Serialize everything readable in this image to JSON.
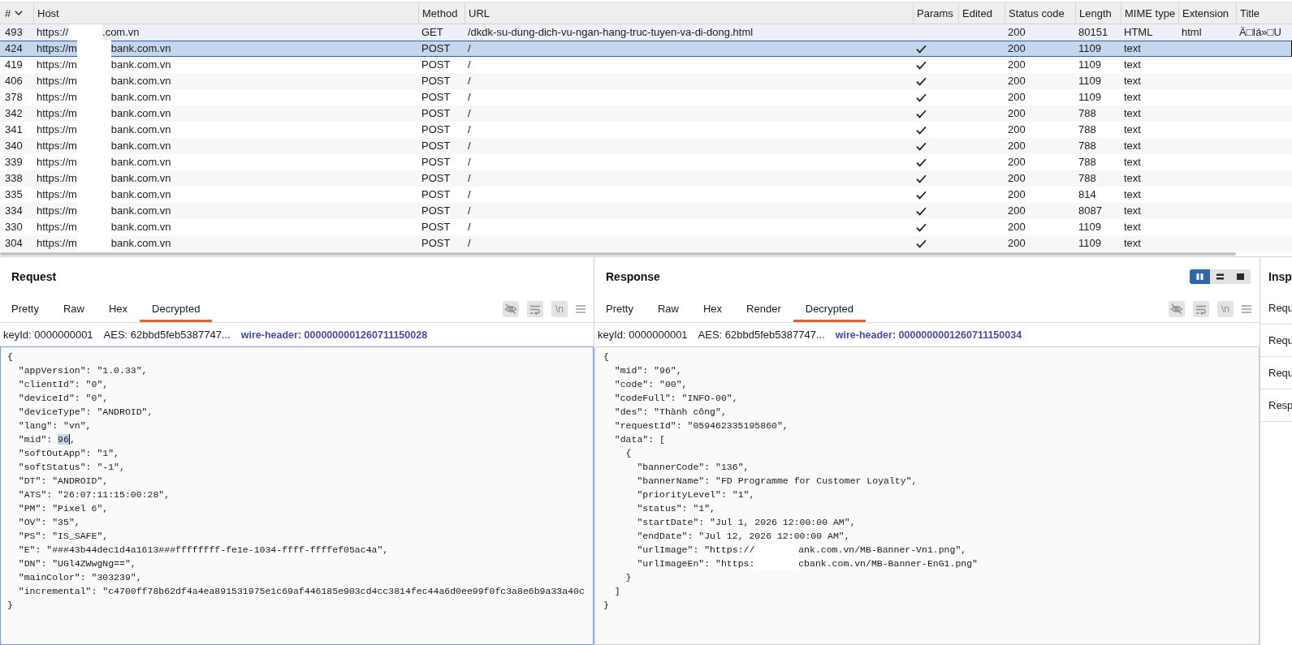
{
  "table": {
    "columns": [
      {
        "label": "#",
        "sorted": true
      },
      {
        "label": "Host",
        "sorted": false
      },
      {
        "label": "Method",
        "sorted": false
      },
      {
        "label": "URL",
        "sorted": false
      },
      {
        "label": "Params",
        "sorted": false
      },
      {
        "label": "Edited",
        "sorted": false
      },
      {
        "label": "Status code",
        "sorted": false
      },
      {
        "label": "Length",
        "sorted": false
      },
      {
        "label": "MIME type",
        "sorted": false
      },
      {
        "label": "Extension",
        "sorted": false
      },
      {
        "label": "Title",
        "sorted": false
      }
    ],
    "rows": [
      {
        "number": "493",
        "host_start": "https://",
        "host_redacted": true,
        "host_end": ".com.vn",
        "method": "GET",
        "url": "/dkdk-su-dung-dich-vu-ngan-hang-truc-tuyen-va-di-dong.html",
        "params": false,
        "status": "200",
        "length": "80151",
        "mime": "HTML",
        "extension": "html",
        "title": "Ä□Iá»□U",
        "selected": false,
        "hovered": true
      },
      {
        "number": "424",
        "host_start": "https://m",
        "host_redacted": true,
        "host_end": "bank.com.vn",
        "method": "POST",
        "url": "/",
        "params": true,
        "status": "200",
        "length": "1109",
        "mime": "text",
        "selected": true,
        "hovered": false
      },
      {
        "number": "419",
        "host_start": "https://m",
        "host_redacted": true,
        "host_end": "bank.com.vn",
        "method": "POST",
        "url": "/",
        "params": true,
        "status": "200",
        "length": "1109",
        "mime": "text",
        "selected": false,
        "hovered": false
      },
      {
        "number": "406",
        "host_start": "https://m",
        "host_redacted": true,
        "host_end": "bank.com.vn",
        "method": "POST",
        "url": "/",
        "params": true,
        "status": "200",
        "length": "1109",
        "mime": "text",
        "selected": false,
        "hovered": false
      },
      {
        "number": "378",
        "host_start": "https://m",
        "host_redacted": true,
        "host_end": "bank.com.vn",
        "method": "POST",
        "url": "/",
        "params": true,
        "status": "200",
        "length": "1109",
        "mime": "text",
        "selected": false,
        "hovered": false
      },
      {
        "number": "342",
        "host_start": "https://m",
        "host_redacted": true,
        "host_end": "bank.com.vn",
        "method": "POST",
        "url": "/",
        "params": true,
        "status": "200",
        "length": "788",
        "mime": "text",
        "selected": false,
        "hovered": false
      },
      {
        "number": "341",
        "host_start": "https://m",
        "host_redacted": true,
        "host_end": "bank.com.vn",
        "method": "POST",
        "url": "/",
        "params": true,
        "status": "200",
        "length": "788",
        "mime": "text",
        "selected": false,
        "hovered": false
      },
      {
        "number": "340",
        "host_start": "https://m",
        "host_redacted": true,
        "host_end": "bank.com.vn",
        "method": "POST",
        "url": "/",
        "params": true,
        "status": "200",
        "length": "788",
        "mime": "text",
        "selected": false,
        "hovered": false
      },
      {
        "number": "339",
        "host_start": "https://m",
        "host_redacted": true,
        "host_end": "bank.com.vn",
        "method": "POST",
        "url": "/",
        "params": true,
        "status": "200",
        "length": "788",
        "mime": "text",
        "selected": false,
        "hovered": false
      },
      {
        "number": "338",
        "host_start": "https://m",
        "host_redacted": true,
        "host_end": "bank.com.vn",
        "method": "POST",
        "url": "/",
        "params": true,
        "status": "200",
        "length": "788",
        "mime": "text",
        "selected": false,
        "hovered": false
      },
      {
        "number": "335",
        "host_start": "https://m",
        "host_redacted": true,
        "host_end": "bank.com.vn",
        "method": "POST",
        "url": "/",
        "params": true,
        "status": "200",
        "length": "814",
        "mime": "text",
        "selected": false,
        "hovered": false
      },
      {
        "number": "334",
        "host_start": "https://m",
        "host_redacted": true,
        "host_end": "bank.com.vn",
        "method": "POST",
        "url": "/",
        "params": true,
        "status": "200",
        "length": "8087",
        "mime": "text",
        "selected": false,
        "hovered": false
      },
      {
        "number": "330",
        "host_start": "https://m",
        "host_redacted": true,
        "host_end": "bank.com.vn",
        "method": "POST",
        "url": "/",
        "params": true,
        "status": "200",
        "length": "1109",
        "mime": "text",
        "selected": false,
        "hovered": false
      },
      {
        "number": "304",
        "host_start": "https://m",
        "host_redacted": true,
        "host_end": "bank.com.vn",
        "method": "POST",
        "url": "/",
        "params": true,
        "status": "200",
        "length": "1109",
        "mime": "text",
        "selected": false,
        "hovered": false
      }
    ]
  },
  "request": {
    "title": "Request",
    "tabs": [
      {
        "label": "Pretty",
        "selected": false
      },
      {
        "label": "Raw",
        "selected": false
      },
      {
        "label": "Hex",
        "selected": false
      },
      {
        "label": "Decrypted",
        "selected": true
      }
    ],
    "newline_label": "\\n",
    "focused": true,
    "info": {
      "key_id": "keyId: 0000000001",
      "aes": "AES: 62bbd5feb5387747...",
      "wire_header": "wire-header: 0000000001260711150028"
    },
    "body": {
      "text": "{",
      "children": [
        {
          "text": "\"appVersion\": \"1.0.33\","
        },
        {
          "text": "\"clientId\": \"0\","
        },
        {
          "text": "\"deviceId\": \"0\","
        },
        {
          "text": "\"deviceType\": \"ANDROID\","
        },
        {
          "text": "\"lang\": \"vn\","
        },
        {
          "text": "\"mid\": ",
          "selected_text": "96",
          "text_after": ","
        },
        {
          "text": "\"softOutApp\": \"1\","
        },
        {
          "text": "\"softStatus\": \"-1\","
        },
        {
          "text": "\"DT\": \"ANDROID\","
        },
        {
          "text": "\"ATS\": \"26:07:11:15:00:28\","
        },
        {
          "text": "\"PM\": \"Pixel 6\","
        },
        {
          "text": "\"OV\": \"35\","
        },
        {
          "text": "\"PS\": \"IS_SAFE\","
        },
        {
          "text": "\"E\": \"###43b44dec1d4a1613###ffffffff-fe1e-1034-ffff-ffffef05ac4a\","
        },
        {
          "text": "\"DN\": \"UGl4ZWwgNg==\","
        },
        {
          "text": "\"mainColor\": \"303239\","
        },
        {
          "text": "\"incremental\": \"c4700ff78b62df4a4ea891531975e1c69af446185e903cd4cc3814fec44a6d0ee99f0fc3a8e6b9a33a40c"
        }
      ],
      "close": "}"
    }
  },
  "response": {
    "title": "Response",
    "view_modes": [
      {
        "kind": "columns",
        "selected": true
      },
      {
        "kind": "rows",
        "selected": false
      },
      {
        "kind": "single",
        "selected": false
      }
    ],
    "tabs": [
      {
        "label": "Pretty",
        "selected": false
      },
      {
        "label": "Raw",
        "selected": false
      },
      {
        "label": "Hex",
        "selected": false
      },
      {
        "label": "Render",
        "selected": false
      },
      {
        "label": "Decrypted",
        "selected": true
      }
    ],
    "newline_label": "\\n",
    "focused": false,
    "info": {
      "key_id": "keyId: 0000000001",
      "aes": "AES: 62bbd5feb5387747...",
      "wire_header": "wire-header: 0000000001260711150034"
    },
    "body": {
      "text": "{",
      "children": [
        {
          "text": "\"mid\": \"96\","
        },
        {
          "text": "\"code\": \"00\","
        },
        {
          "text": "\"codeFull\": \"INFO-00\","
        },
        {
          "text": "\"des\": \"Thành công\","
        },
        {
          "text": "\"requestId\": \"059462335195860\","
        },
        {
          "text": "\"data\": [",
          "children": [
            {
              "text": "{",
              "children": [
                {
                  "text": "\"bannerCode\": \"136\","
                },
                {
                  "text": "\"bannerName\": \"FD Programme for Customer Loyalty\","
                },
                {
                  "text": "\"priorityLevel\": \"1\","
                },
                {
                  "text": "\"status\": \"1\","
                },
                {
                  "text": "\"startDate\": \"Jul 1, 2026 12:00:00 AM\","
                },
                {
                  "text": "\"endDate\": \"Jul 12, 2026 12:00:00 AM\","
                },
                {
                  "text": "\"urlImage\": \"https://",
                  "redacted": true,
                  "text_after": "ank.com.vn/MB-Banner-Vn1.png\","
                },
                {
                  "text": "\"urlImageEn\": \"https:",
                  "redacted": true,
                  "text_after": "cbank.com.vn/MB-Banner-EnG1.png\""
                }
              ],
              "close": "}"
            }
          ],
          "close": "]"
        }
      ],
      "close": "}"
    }
  },
  "inspector": {
    "title": "Insp",
    "rows": [
      "Requ",
      "Requ",
      "Requ",
      "Resp"
    ]
  }
}
